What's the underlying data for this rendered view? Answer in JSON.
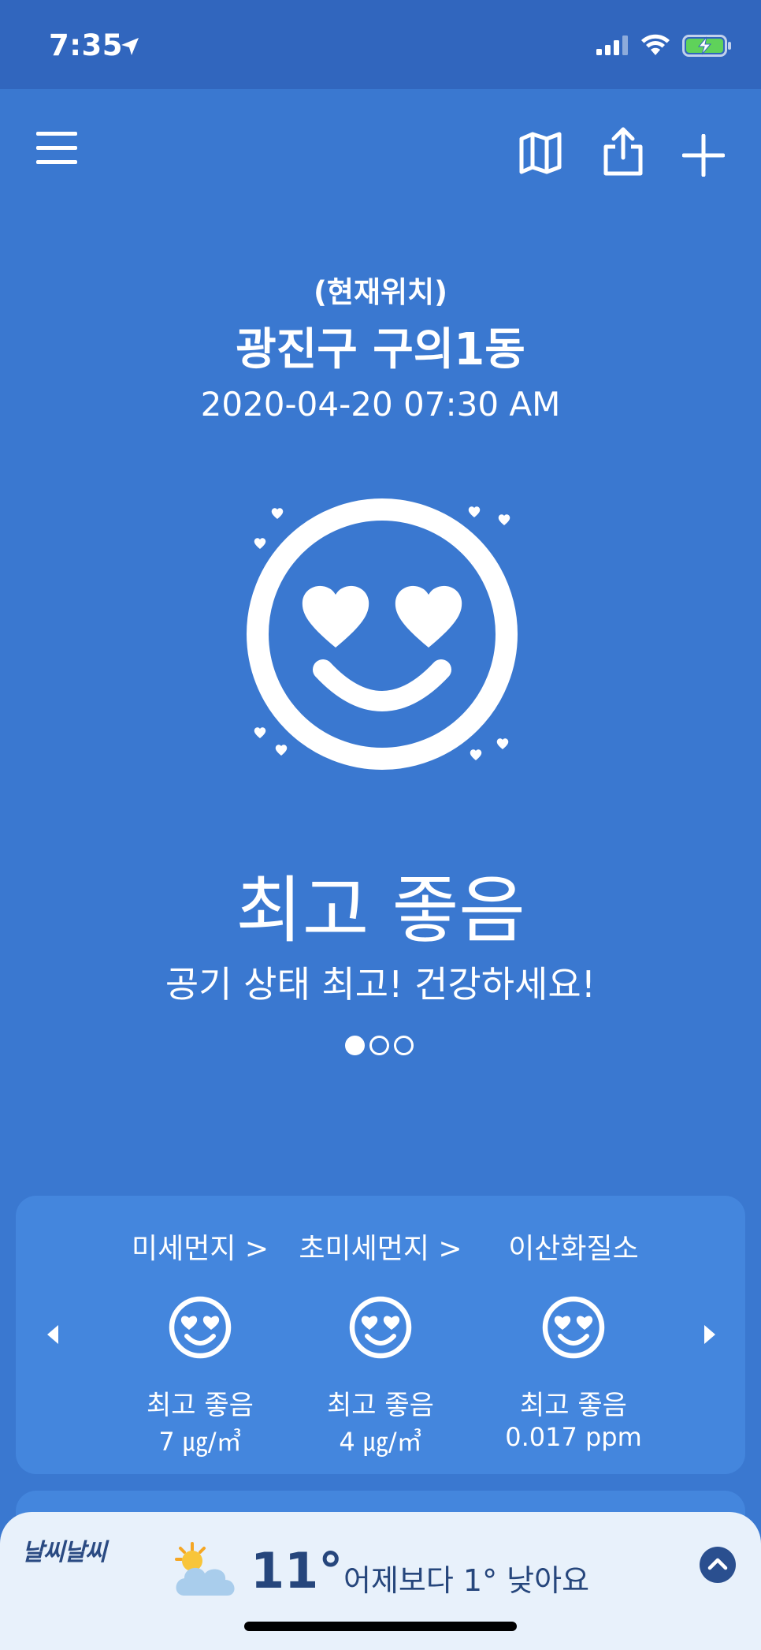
{
  "status_bar": {
    "time": "7:35"
  },
  "location": {
    "prefix": "(현재위치)",
    "name": "광진구 구의1동",
    "datetime": "2020-04-20 07:30 AM"
  },
  "overall": {
    "grade": "최고 좋음",
    "message": "공기 상태 최고! 건강하세요!",
    "page_count": 3,
    "active_page": 1
  },
  "pollutants": [
    {
      "name": "미세먼지 >",
      "grade": "최고 좋음",
      "value": "7 ㎍/㎥"
    },
    {
      "name": "초미세먼지 >",
      "grade": "최고 좋음",
      "value": "4 ㎍/㎥"
    },
    {
      "name": "이산화질소",
      "grade": "최고 좋음",
      "value": "0.017 ppm"
    }
  ],
  "weather": {
    "brand": "날씨날씨",
    "temperature": "11°",
    "comparison": "어제보다 1° 낮아요",
    "icon": "partly-cloudy-icon"
  },
  "colors": {
    "background": "#3a78d0",
    "status_bar": "#3166be",
    "card": "#4486dd",
    "panel": "#e8f1fb",
    "panel_text": "#26467c"
  }
}
